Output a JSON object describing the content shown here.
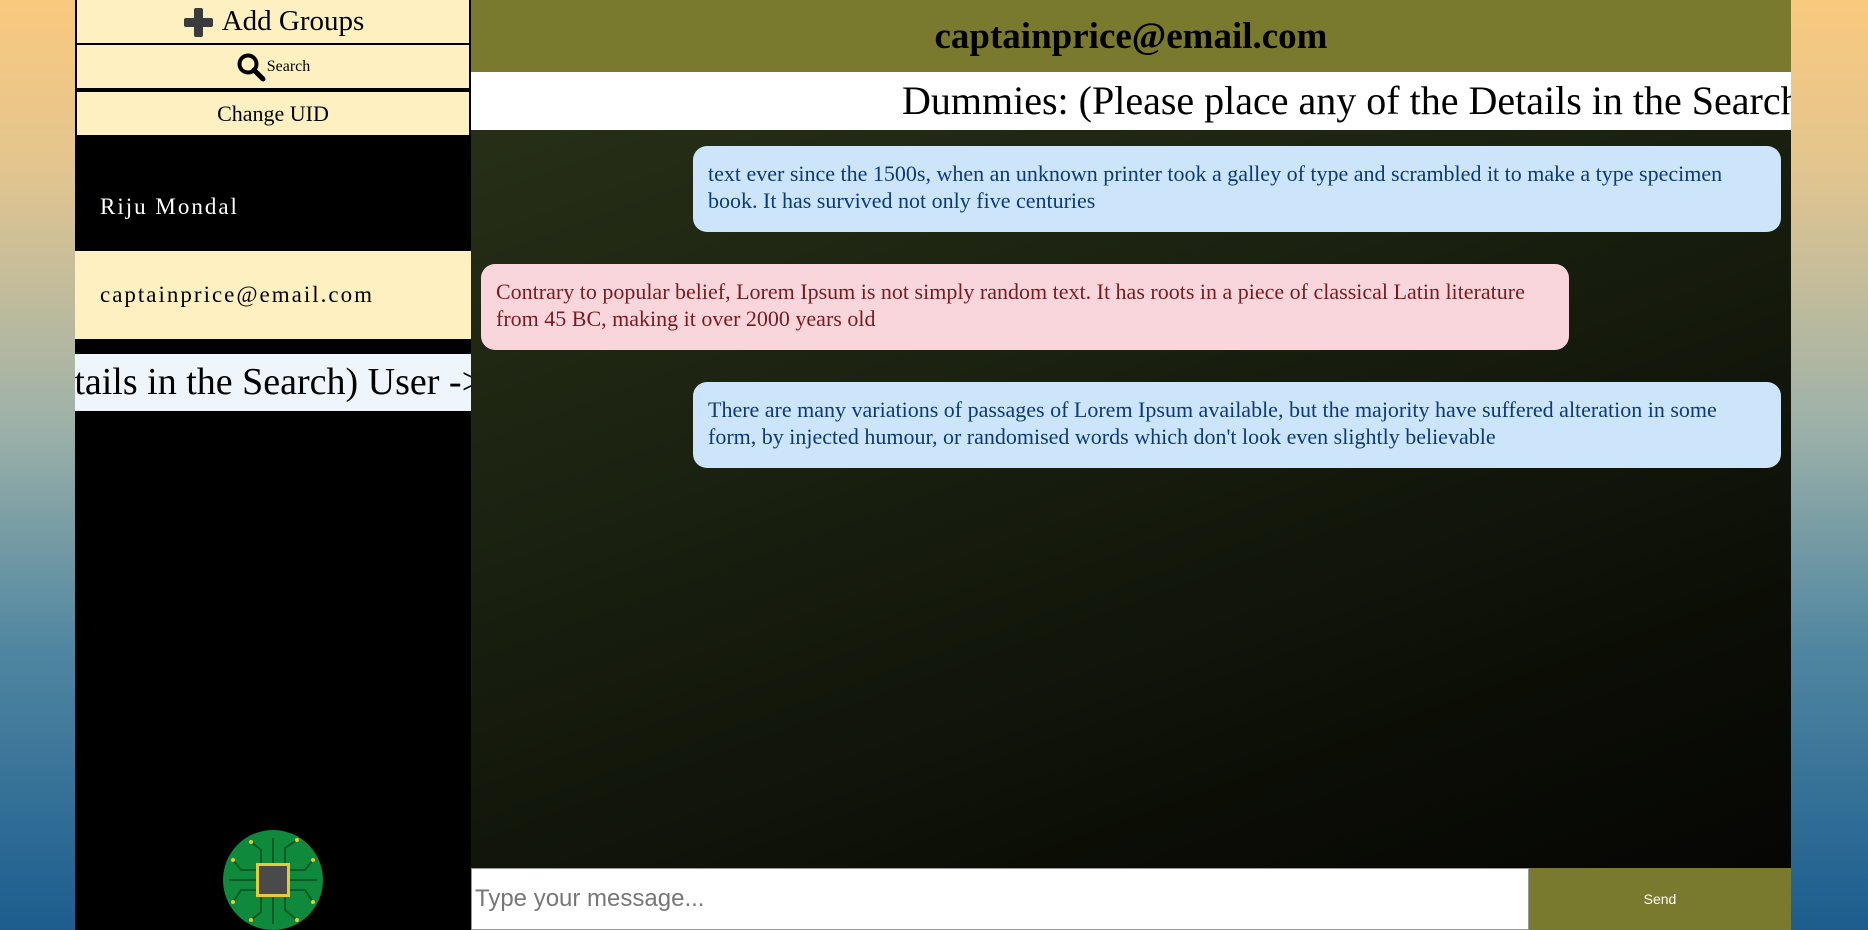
{
  "sidebar": {
    "add_groups_label": "Add Groups",
    "search_label": "Search",
    "change_uid_label": "Change UID",
    "contacts": [
      {
        "label": "Riju Mondal"
      },
      {
        "label": "captainprice@email.com"
      }
    ],
    "marquee_text": "Dummies: (Please place any of the Details in the Search) User ->"
  },
  "header": {
    "title": "captainprice@email.com",
    "marquee_text": "Dummies: (Please place any of the Details in the Search) User ->"
  },
  "messages": [
    {
      "type": "sent",
      "text": "text ever since the 1500s, when an unknown printer took a galley of type and scrambled it to make a type specimen book. It has survived not only five centuries"
    },
    {
      "type": "received",
      "text": "Contrary to popular belief, Lorem Ipsum is not simply random text. It has roots in a piece of classical Latin literature from 45 BC, making it over 2000 years old"
    },
    {
      "type": "sent",
      "text": "There are many variations of passages of Lorem Ipsum available, but the majority have suffered alteration in some form, by injected humour, or randomised words which don't look even slightly believable"
    }
  ],
  "composer": {
    "placeholder": "Type your message...",
    "send_label": "Send"
  },
  "icons": {
    "add": "plus-icon",
    "search": "magnifier-icon",
    "logo": "circuit-chip-logo"
  },
  "colors": {
    "sidebar_button_bg": "#fff0c2",
    "header_bg": "#7a7a2f",
    "sent_bubble": "#cde5fb",
    "received_bubble": "#f9d6db"
  }
}
